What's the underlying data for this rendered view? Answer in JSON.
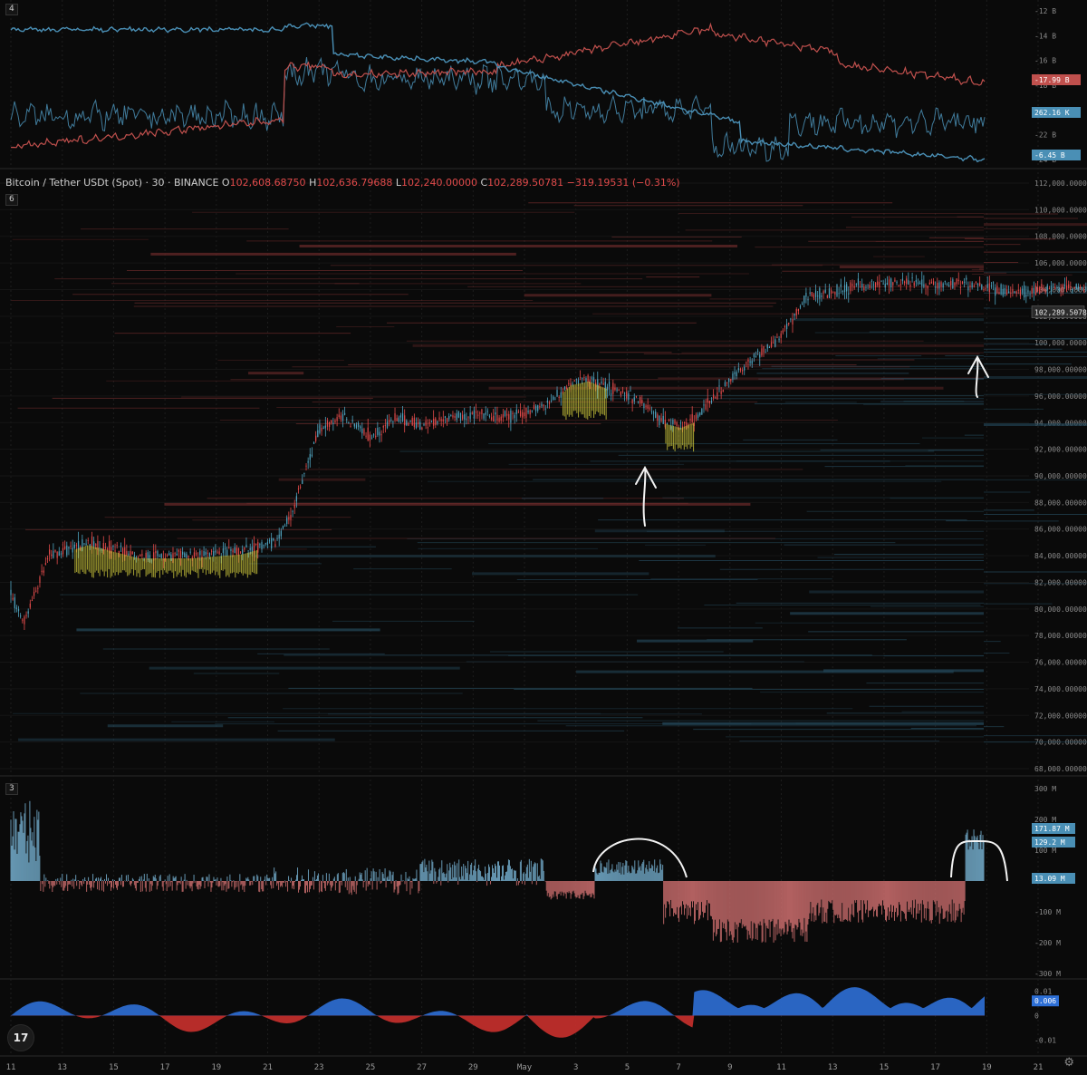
{
  "panels": {
    "top": {
      "tag": "4",
      "axis_labels": [
        "-12 B",
        "-14 B",
        "-16 B",
        "-18 B",
        "-20 B",
        "-22 B",
        "-24 B"
      ],
      "badges": [
        {
          "text": "-17.99 B",
          "color": "#c0504d"
        },
        {
          "text": "262.16 K",
          "color": "#4a8fb5"
        },
        {
          "text": "-6.45 B",
          "color": "#4a8fb5"
        }
      ]
    },
    "price": {
      "tag": "6",
      "legend": {
        "symbol": "Bitcoin / Tether USDt (Spot) · 30 · BINANCE",
        "o_key": "O",
        "o": "102,608.68750",
        "h_key": "H",
        "h": "102,636.79688",
        "l_key": "L",
        "l": "102,240.00000",
        "c_key": "C",
        "c": "102,289.50781",
        "chg": "−319.19531 (−0.31%)"
      },
      "axis_labels": [
        "112,000.00000",
        "110,000.00000",
        "108,000.00000",
        "106,000.00000",
        "104,000.00000",
        "102,000.00000",
        "100,000.00000",
        "98,000.00000",
        "96,000.00000",
        "94,000.00000",
        "92,000.00000",
        "90,000.00000",
        "88,000.00000",
        "86,000.00000",
        "84,000.00000",
        "82,000.00000",
        "80,000.00000",
        "78,000.00000",
        "76,000.00000",
        "74,000.00000",
        "72,000.00000",
        "70,000.00000",
        "68,000.00000"
      ],
      "last_price_badge": "102,289.50781"
    },
    "hist": {
      "tag": "3",
      "axis_labels": [
        "300 M",
        "200 M",
        "100 M",
        "-100 M",
        "-200 M",
        "-300 M"
      ],
      "badges": [
        {
          "text": "171.87 M",
          "color": "#4a8fb5"
        },
        {
          "text": "129.2 M",
          "color": "#4a8fb5"
        },
        {
          "text": "13.09 M",
          "color": "#4a8fb5"
        }
      ]
    },
    "osc": {
      "axis_labels": [
        "0.01",
        "0",
        "-0.01"
      ],
      "badge": {
        "text": "0.006",
        "color": "#2d6fd6"
      }
    }
  },
  "x_axis": {
    "labels": [
      "11",
      "13",
      "15",
      "17",
      "19",
      "21",
      "23",
      "25",
      "27",
      "29",
      "May",
      "3",
      "5",
      "7",
      "9",
      "11",
      "13",
      "15",
      "17",
      "19",
      "21"
    ]
  },
  "logo": "17",
  "chart_data": [
    {
      "type": "candlestick",
      "title": "Bitcoin / Tether USDt (Spot) · 30 · BINANCE",
      "ylim": [
        68000,
        112000
      ],
      "x_ticks": [
        "11",
        "13",
        "15",
        "17",
        "19",
        "21",
        "23",
        "25",
        "27",
        "29",
        "May",
        "3",
        "5",
        "7",
        "9",
        "11",
        "13",
        "15",
        "17",
        "19",
        "21"
      ],
      "close_path_anchors": [
        [
          0,
          81000
        ],
        [
          0.5,
          79000
        ],
        [
          1.5,
          84000
        ],
        [
          3,
          85000
        ],
        [
          5,
          84000
        ],
        [
          7,
          84000
        ],
        [
          9,
          84300
        ],
        [
          10.3,
          85000
        ],
        [
          11,
          87500
        ],
        [
          12,
          93500
        ],
        [
          13,
          94500
        ],
        [
          14,
          93000
        ],
        [
          15,
          94300
        ],
        [
          16,
          93800
        ],
        [
          17,
          94400
        ],
        [
          18,
          94600
        ],
        [
          19,
          94300
        ],
        [
          20,
          94700
        ],
        [
          21,
          95500
        ],
        [
          21.8,
          97000
        ],
        [
          22.5,
          97300
        ],
        [
          23.5,
          96500
        ],
        [
          24.6,
          95500
        ],
        [
          25.3,
          94200
        ],
        [
          26.1,
          93800
        ],
        [
          26.6,
          94200
        ],
        [
          27.2,
          95500
        ],
        [
          28,
          97200
        ],
        [
          29,
          99000
        ],
        [
          30,
          100500
        ],
        [
          31,
          103500
        ],
        [
          33,
          104300
        ],
        [
          35,
          104500
        ],
        [
          36,
          104300
        ],
        [
          37,
          104500
        ],
        [
          39,
          103800
        ],
        [
          41,
          104100
        ],
        [
          42,
          104200
        ],
        [
          43,
          104000
        ],
        [
          44,
          104400
        ],
        [
          45,
          104700
        ],
        [
          45.7,
          105500
        ],
        [
          46.3,
          103300
        ],
        [
          46.6,
          102289
        ]
      ],
      "last": 102289.50781,
      "ohlc": {
        "o": 102608.6875,
        "h": 102636.79688,
        "l": 102240.0,
        "c": 102289.50781
      }
    },
    {
      "type": "line",
      "series": [
        {
          "color": "#4a8fb5"
        },
        {
          "color": "#c0504d"
        }
      ],
      "ylim": [
        -24,
        -12
      ]
    },
    {
      "type": "bar",
      "ylim": [
        -300,
        300
      ],
      "last_values": [
        171.87,
        129.2,
        13.09
      ]
    },
    {
      "type": "area",
      "ylim": [
        -0.015,
        0.012
      ],
      "last": 0.006
    }
  ],
  "colors": {
    "up": "#4fa3bf",
    "down": "#e24b4b",
    "heat_yellow": "#c8c23a",
    "blue_area": "#2d6fd6",
    "red_area": "#c9302c",
    "grid": "#1d1d1d"
  }
}
